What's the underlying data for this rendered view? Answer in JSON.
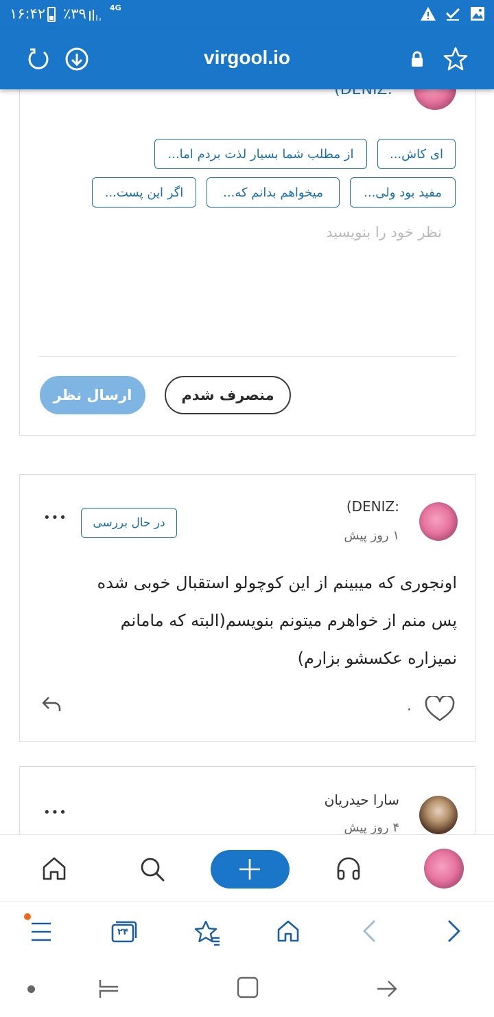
{
  "status_bar": {
    "time": "۱۶:۴۲",
    "battery": "٪۳۹",
    "network": "4G"
  },
  "browser": {
    "domain": "virgool.io"
  },
  "comment_form": {
    "author_partial": ":DENIZ)",
    "suggestions_row1": [
      "ای کاش...",
      "از مطلب شما بسیار لذت بردم اما..."
    ],
    "suggestions_row2": [
      "مفید بود ولی...",
      "میخواهم بدانم که...",
      "اگر این پست..."
    ],
    "placeholder": "نظر خود را بنویسید",
    "cancel_label": "منصرف شدم",
    "submit_label": "ارسال نظر"
  },
  "comments": [
    {
      "author": ":DENIZ)",
      "time": "۱ روز پیش",
      "status_badge": "در حال بررسی",
      "more": "•••",
      "lines": [
        "اونجوری که میبینم از این کوچولو استقبال خوبی شده",
        "پس منم از خواهرم میتونم بنویسم(البته که مامانم",
        "نمیزاره عکسشو بزارم)"
      ],
      "likes": "۰"
    },
    {
      "author": "سارا حیدریان",
      "time": "۴ روز پیش",
      "more": "•••"
    }
  ],
  "browser_nav": {
    "tabs_count": "۲۴"
  },
  "colors": {
    "primary": "#1976c9",
    "link": "#1b6fa8",
    "submit_disabled": "#7fb5e3"
  }
}
